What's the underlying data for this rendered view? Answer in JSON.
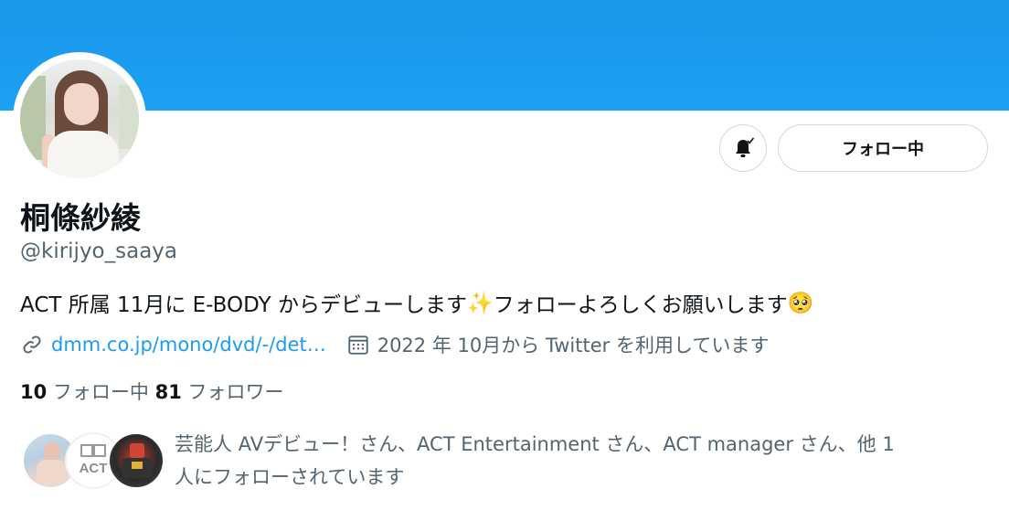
{
  "profile": {
    "name": "桐條紗綾",
    "handle": "@kirijyo_saaya",
    "bio_text": "ACT 所属 11月に E-BODY からデビューします",
    "bio_text2": " フォローよろしくお願いします",
    "bio_emoji1": "✨",
    "bio_emoji2": "🥺",
    "link": "dmm.co.jp/mono/dvd/-/det…",
    "joined": "2022 年 10月から Twitter を利用しています"
  },
  "actions": {
    "follow_label": "フォロー中",
    "notify_icon": "bell-check-icon"
  },
  "stats": {
    "following_count": "10",
    "following_label": "フォロー中",
    "followers_count": "81",
    "followers_label": "フォロワー"
  },
  "followed_by": {
    "line1": "芸能人 AVデビュー！さん、ACT Entertainment さん、ACT manager さん、他 1",
    "line2": "人にフォローされています"
  },
  "colors": {
    "banner": "#1da1f2",
    "link": "#1d9bf0",
    "secondary_text": "#536471"
  }
}
